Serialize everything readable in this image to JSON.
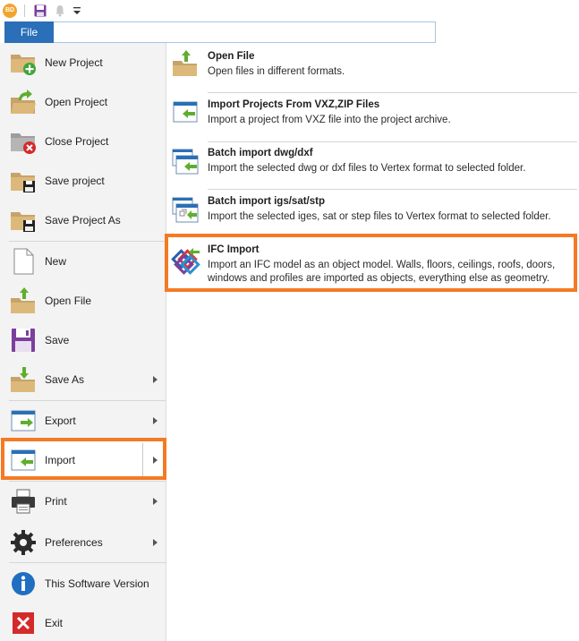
{
  "qat": {
    "app_badge": "BD",
    "icons": [
      "app-badge-icon",
      "save-icon",
      "bell-icon",
      "dropdown-arrow-icon"
    ]
  },
  "ribbon": {
    "file_tab": "File"
  },
  "menu": {
    "items": [
      {
        "label": "New Project",
        "icon": "new-project-icon"
      },
      {
        "label": "Open Project",
        "icon": "open-project-icon"
      },
      {
        "label": "Close Project",
        "icon": "close-project-icon"
      },
      {
        "label": "Save project",
        "icon": "save-project-icon"
      },
      {
        "label": "Save Project As",
        "icon": "save-project-as-icon"
      },
      {
        "label": "New",
        "icon": "new-document-icon"
      },
      {
        "label": "Open File",
        "icon": "open-file-icon"
      },
      {
        "label": "Save",
        "icon": "floppy-icon"
      },
      {
        "label": "Save As",
        "icon": "save-as-icon"
      },
      {
        "label": "Export",
        "icon": "export-icon"
      },
      {
        "label": "Import",
        "icon": "import-icon"
      },
      {
        "label": "Print",
        "icon": "printer-icon"
      },
      {
        "label": "Preferences",
        "icon": "gear-icon"
      },
      {
        "label": "This Software Version",
        "icon": "info-icon"
      },
      {
        "label": "Exit",
        "icon": "exit-icon"
      }
    ],
    "selected": "Import"
  },
  "panel": {
    "items": [
      {
        "title": "Open File",
        "desc": "Open files in different formats.",
        "icon": "open-file-icon"
      },
      {
        "title": "Import Projects From VXZ,ZIP Files",
        "desc": "Import a project from VXZ file into the project archive.",
        "icon": "import-icon"
      },
      {
        "title": "Batch import dwg/dxf",
        "desc": "Import the selected dwg or dxf files to Vertex format to selected folder.",
        "icon": "batch-import-icon"
      },
      {
        "title": "Batch import igs/sat/stp",
        "desc": "Import the selected iges, sat or step files to Vertex format to selected folder.",
        "icon": "batch-import-3d-icon"
      },
      {
        "title": "IFC Import",
        "desc": "Import an IFC model as an object model. Walls, floors, ceilings, roofs, doors, windows and profiles are imported as objects, everything else as geometry.",
        "icon": "ifc-logo-icon"
      }
    ]
  },
  "colors": {
    "accent_blue": "#2a6fb8",
    "highlight_orange": "#f47a24",
    "menu_bg": "#f3f3f3",
    "green_arrow": "#5fae2e"
  }
}
